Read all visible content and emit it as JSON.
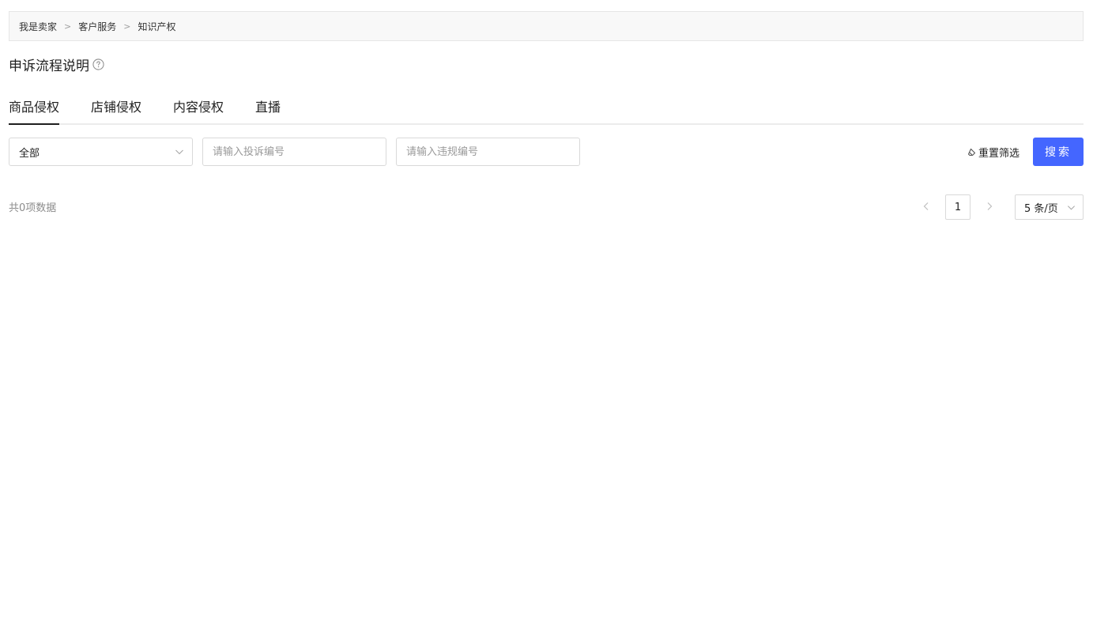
{
  "breadcrumb": {
    "items": [
      "我是卖家",
      "客户服务",
      "知识产权"
    ],
    "separator": ">"
  },
  "page": {
    "title": "申诉流程说明"
  },
  "tabs": [
    {
      "label": "商品侵权",
      "active": true
    },
    {
      "label": "店铺侵权",
      "active": false
    },
    {
      "label": "内容侵权",
      "active": false
    },
    {
      "label": "直播",
      "active": false
    }
  ],
  "filters": {
    "category_value": "全部",
    "complaint_placeholder": "请输入投诉编号",
    "violation_placeholder": "请输入违规编号",
    "reset_label": "重置筛选",
    "search_label": "搜索"
  },
  "results": {
    "total_text": "共0项数据"
  },
  "pagination": {
    "current_page": "1",
    "page_size": "5 条/页"
  },
  "colors": {
    "primary": "#4466ff",
    "border": "#d9d9d9",
    "breadcrumb_bg": "#f8f8f8"
  },
  "icons": {
    "help": "question-circle-icon",
    "chevron": "chevron-down-icon",
    "eraser": "eraser-icon",
    "prev": "chevron-left-icon",
    "next": "chevron-right-icon"
  }
}
